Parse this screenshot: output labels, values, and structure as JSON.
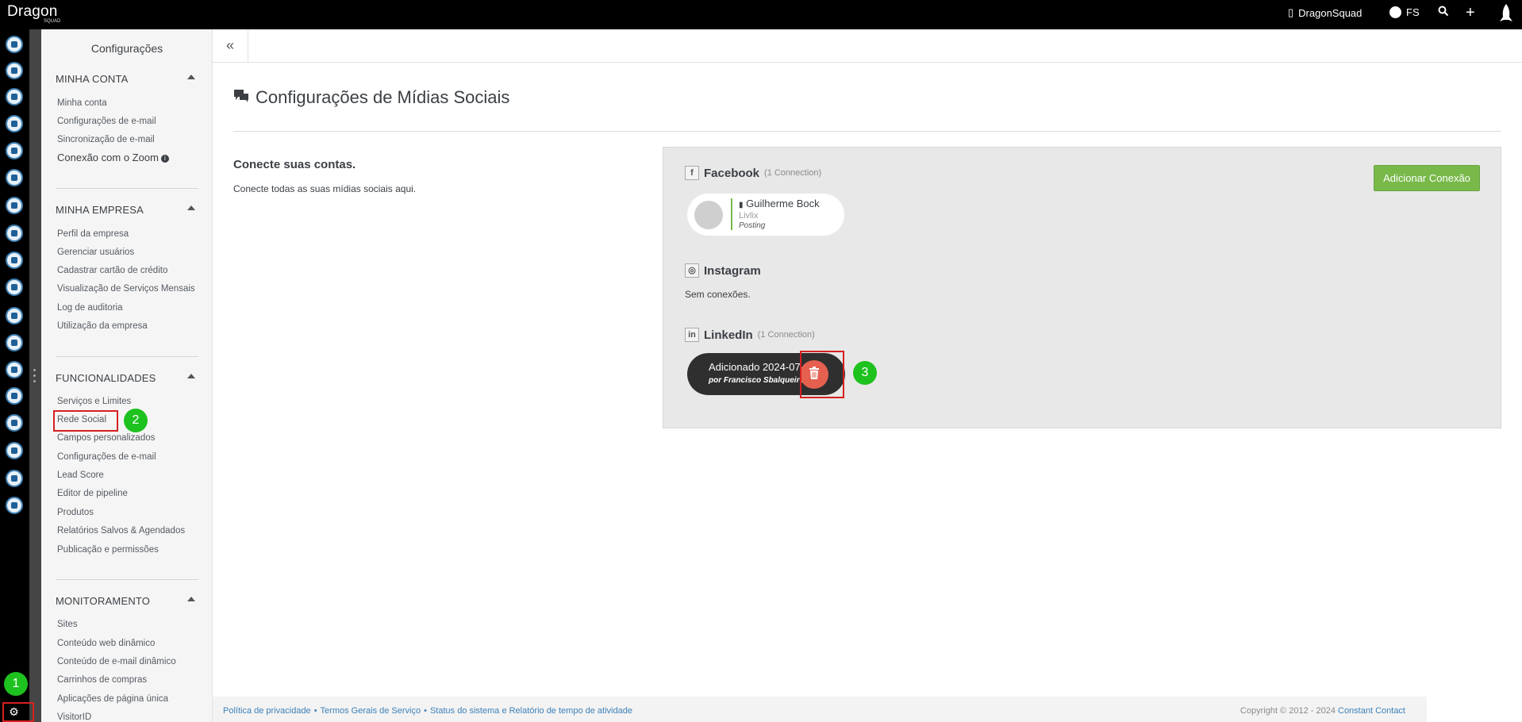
{
  "app": {
    "logo_text": "Dragon",
    "logo_sub": "SQUAD",
    "company": "DragonSquad",
    "user": "FS"
  },
  "settings_nav": {
    "title": "Configurações",
    "sections": [
      {
        "heading": "MINHA CONTA",
        "links": [
          "Minha conta",
          "Configurações de e-mail",
          "Sincronização de e-mail",
          "Conexão com o Zoom"
        ]
      },
      {
        "heading": "MINHA EMPRESA",
        "links": [
          "Perfil da empresa",
          "Gerenciar usuários",
          "Cadastrar cartão de crédito",
          "Visualização de Serviços Mensais",
          "Log de auditoria",
          "Utilização da empresa"
        ]
      },
      {
        "heading": "FUNCIONALIDADES",
        "links": [
          "Serviços e Limites",
          "Rede Social",
          "Campos personalizados",
          "Configurações de e-mail",
          "Lead Score",
          "Editor de pipeline",
          "Produtos",
          "Relatórios Salvos & Agendados",
          "Publicação e permissões"
        ]
      },
      {
        "heading": "MONITORAMENTO",
        "links": [
          "Sites",
          "Conteúdo web dinâmico",
          "Conteúdo de e-mail dinâmico",
          "Carrinhos de compras",
          "Aplicações de página única",
          "VisitorID"
        ]
      }
    ]
  },
  "main": {
    "collapse_glyph": "«",
    "title": "Configurações de Mídias Sociais",
    "connect_heading": "Conecte suas contas.",
    "connect_description": "Conecte todas as suas mídias sociais aqui.",
    "add_button": "Adicionar Conexão",
    "facebook": {
      "name": "Facebook",
      "count": "(1 Connection)",
      "connection": {
        "name": "Guilherme Bock",
        "org": "Livlix",
        "permission": "Posting"
      }
    },
    "instagram": {
      "name": "Instagram",
      "empty": "Sem conexões."
    },
    "linkedin": {
      "name": "LinkedIn",
      "count": "(1 Connection)",
      "connection": {
        "added": "Adicionado 2024-07-31",
        "by": "por Francisco Sbalqueiro"
      }
    }
  },
  "markers": [
    "1",
    "2",
    "3"
  ],
  "footer": {
    "link_privacy": "Política de privacidade",
    "link_terms": "Termos Gerais de Serviço",
    "link_status": "Status do sistema e Relatório de tempo de atividade",
    "copyright": "Copyright © 2012 - 2024",
    "brand_link": "Constant Contact"
  },
  "colors": {
    "accent_green": "#78b94a",
    "delete_red": "#e5604f",
    "marker_green": "#1ec21e",
    "highlight_red": "#d62020",
    "link_blue": "#3d80b8"
  }
}
